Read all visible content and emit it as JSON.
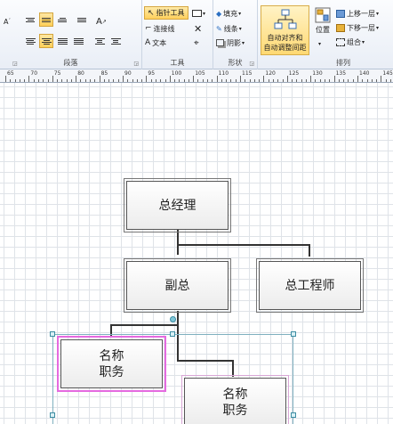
{
  "ribbon": {
    "paragraph": {
      "label": "段落"
    },
    "tools": {
      "label": "工具",
      "pointer": "指针工具",
      "connector": "连接线",
      "text": "文本"
    },
    "shape": {
      "label": "形状",
      "fill": "填充",
      "line": "线条",
      "shadow": "阴影"
    },
    "arrange": {
      "label": "排列",
      "auto_align_line1": "自动对齐和",
      "auto_align_line2": "自动调整间距",
      "position": "位置",
      "bring_forward": "上移一层",
      "send_backward": "下移一层",
      "group": "组合"
    }
  },
  "ruler": {
    "labels": [
      "65",
      "70",
      "75",
      "80",
      "85",
      "90",
      "95",
      "100",
      "105",
      "110",
      "115",
      "120",
      "125",
      "130",
      "135",
      "140",
      "145"
    ]
  },
  "diagram": {
    "nodes": {
      "gm": "总经理",
      "vice": "副总",
      "engineer": "总工程师",
      "name1_line1": "名称",
      "name1_line2": "职务",
      "name2_line1": "名称",
      "name2_line2": "职务"
    }
  },
  "colors": {
    "accent_highlight": "#ffd05c",
    "selection_pink": "#e56ae0",
    "selection_handle": "#3d8da3"
  }
}
